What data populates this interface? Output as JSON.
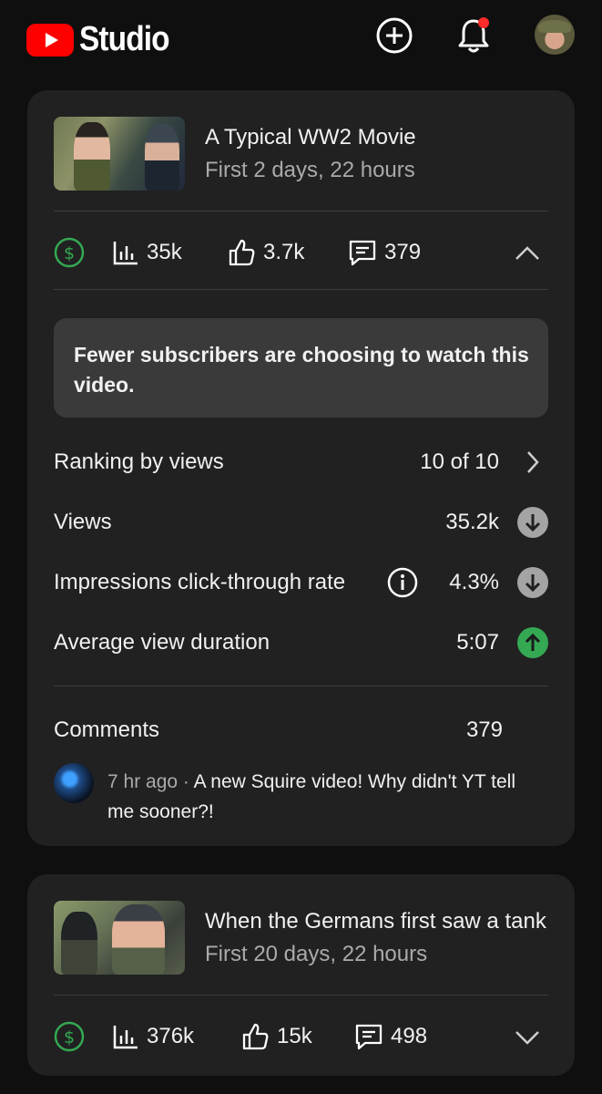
{
  "header": {
    "logo_text": "Studio",
    "icons": [
      "youtube-logo-icon",
      "create-plus-icon",
      "bell-icon",
      "avatar"
    ],
    "brand_color": "#ff0000"
  },
  "video1": {
    "title": "A Typical WW2 Movie",
    "subtitle": "First 2 days, 22 hours",
    "views": "35k",
    "likes": "3.7k",
    "comments_count": "379",
    "insight": "Fewer subscribers are choosing to watch this video.",
    "metrics": [
      {
        "label": "Ranking by views",
        "value": "10 of 10",
        "indicator": "chevron-right"
      },
      {
        "label": "Views",
        "value": "35.2k",
        "indicator": "down"
      },
      {
        "label": "Impressions click-through rate",
        "value": "4.3%",
        "indicator": "down"
      },
      {
        "label": "Average view duration",
        "value": "5:07",
        "indicator": "up"
      }
    ],
    "comments_label": "Comments",
    "comments_total": "379",
    "latest_comment": {
      "time": "7 hr ago",
      "separator": "·",
      "text": "A new Squire video! Why didn't YT tell me sooner?!"
    }
  },
  "video2": {
    "title": "When the Germans first saw a tank",
    "subtitle": "First 20 days, 22 hours",
    "views": "376k",
    "likes": "15k",
    "comments_count": "498"
  },
  "colors": {
    "background": "#0f0f0f",
    "card": "#212121",
    "monetization_green": "#34a853",
    "down_indicator": "#a4a4a4",
    "up_indicator": "#34a853"
  }
}
